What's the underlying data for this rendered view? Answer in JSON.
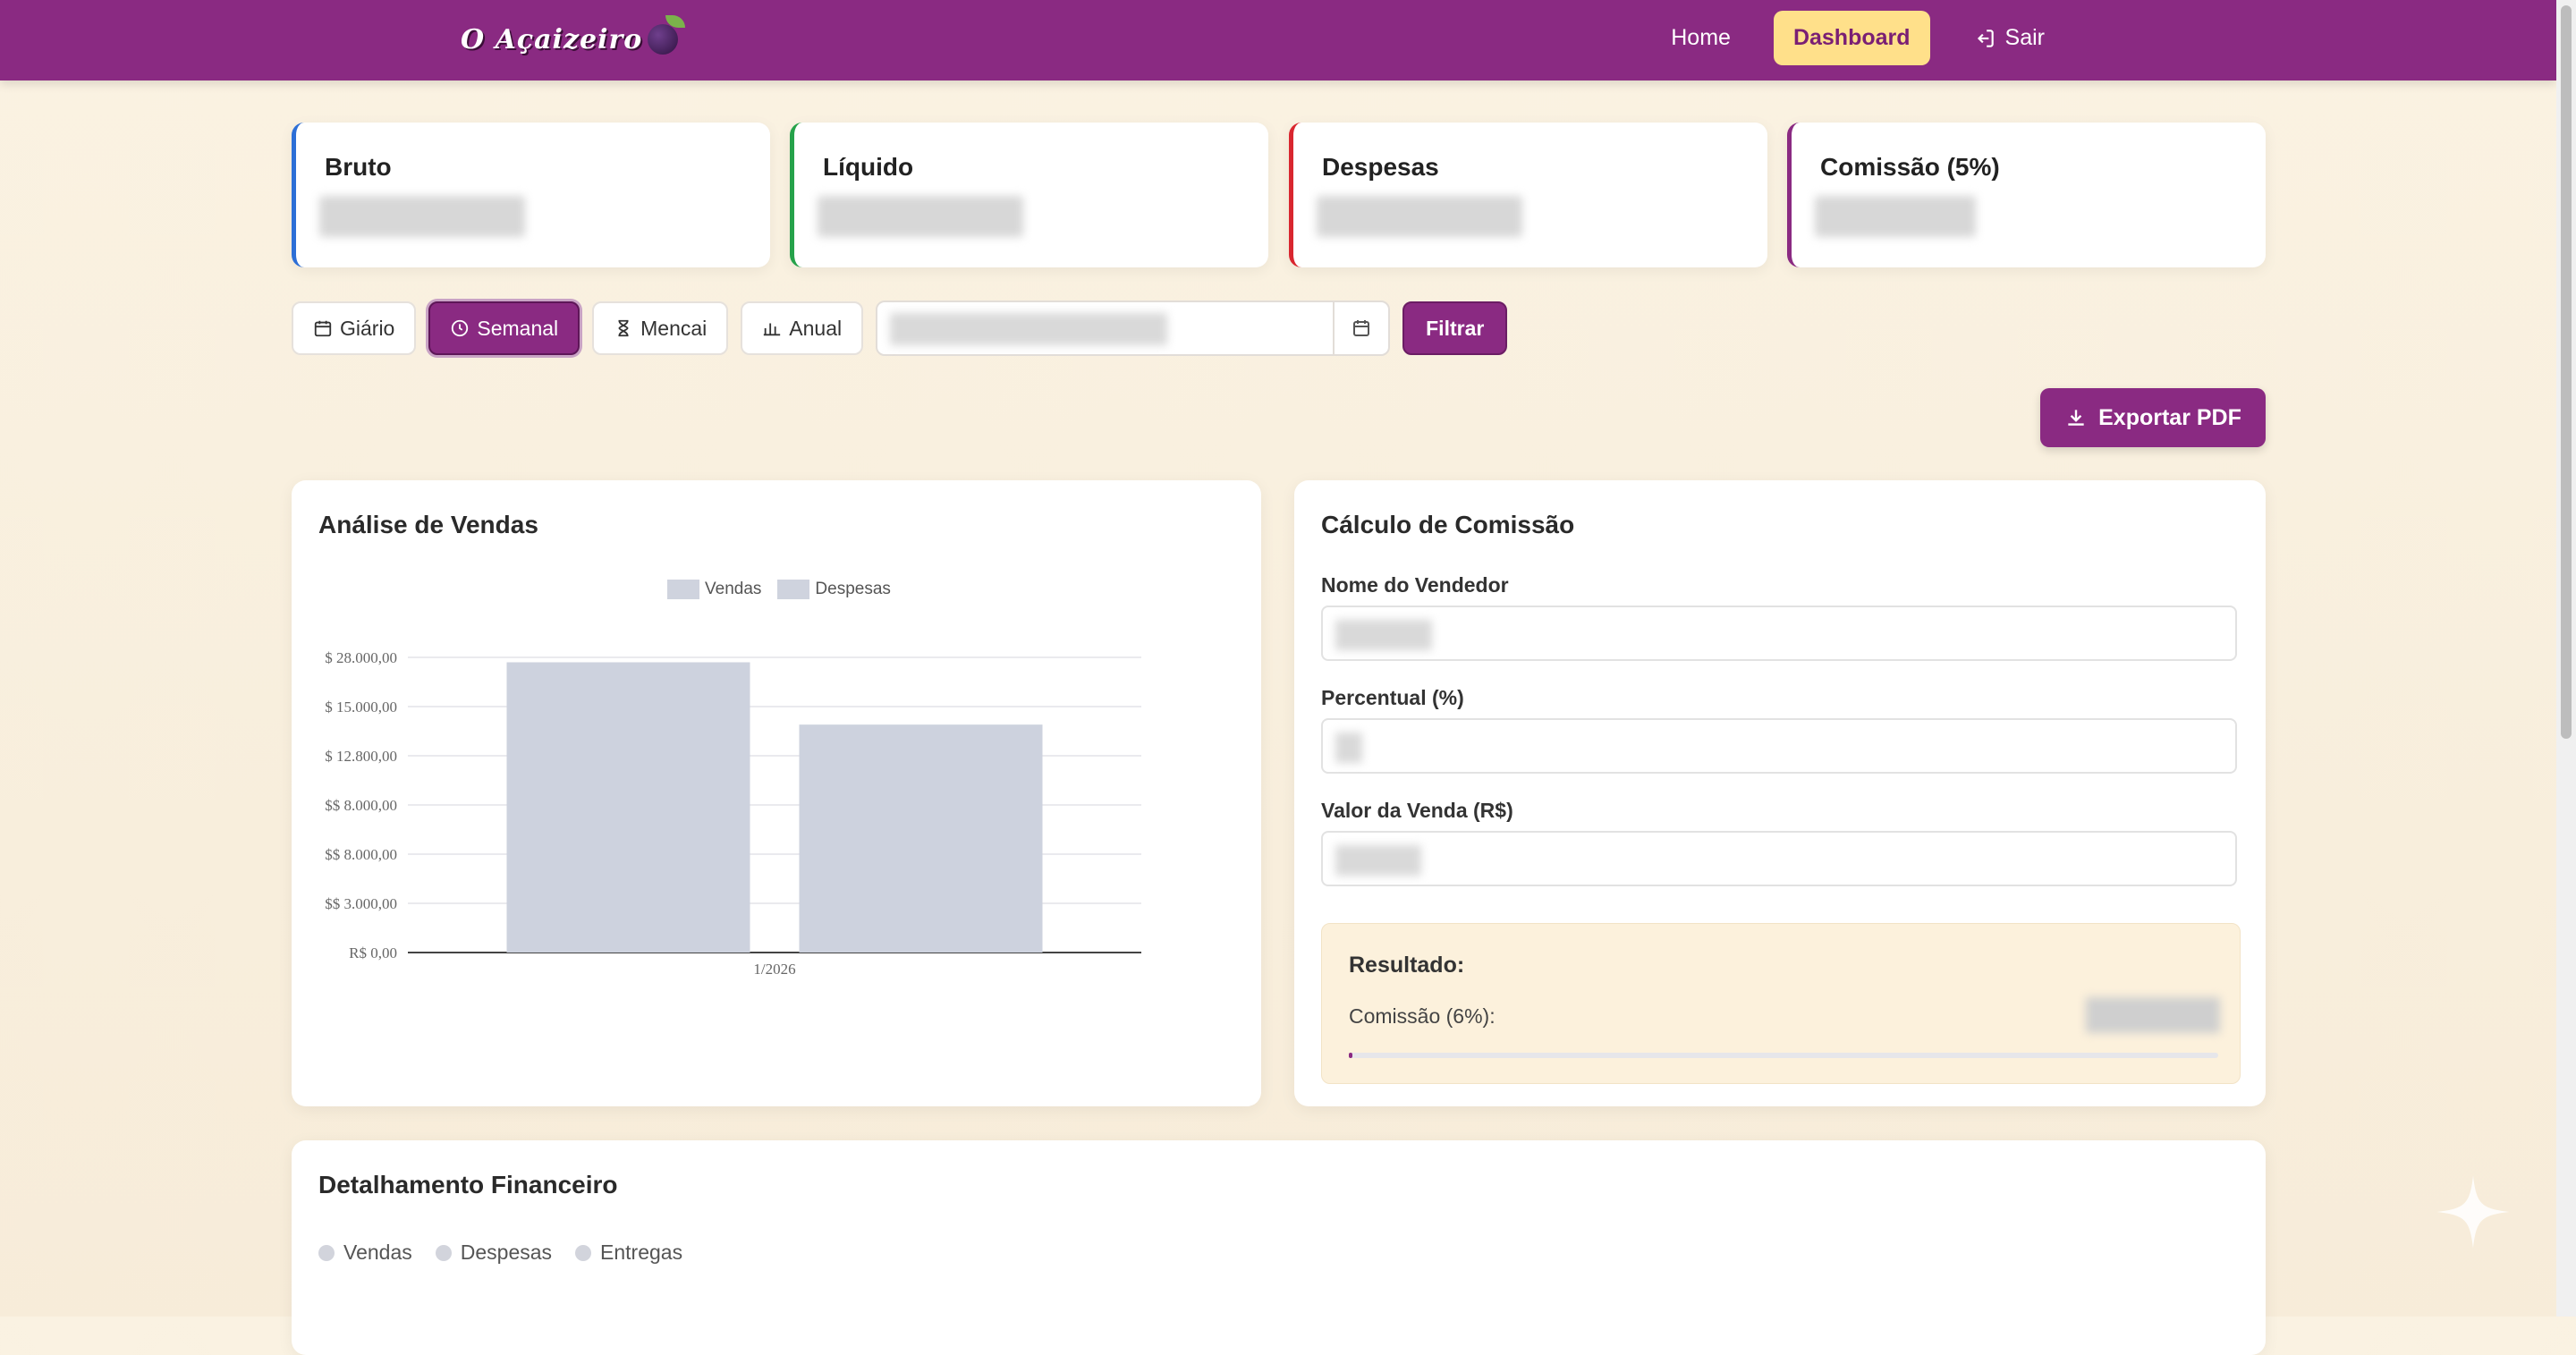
{
  "brand": {
    "logo_text": "O Açaizeiro"
  },
  "nav": {
    "home": "Home",
    "dashboard": "Dashboard",
    "logout": "Sair"
  },
  "summary_cards": [
    {
      "title": "Bruto",
      "color": "#2d6fd6"
    },
    {
      "title": "Líquido",
      "color": "#26a24a"
    },
    {
      "title": "Despesas",
      "color": "#d9262f"
    },
    {
      "title": "Comissão (5%)",
      "color": "#8a2a82"
    }
  ],
  "period_filters": {
    "daily": "Giário",
    "weekly": "Semanal",
    "monthly": "Mencai",
    "yearly": "Anual",
    "filter": "Filtrar"
  },
  "export": {
    "label": "Exportar PDF"
  },
  "sales_panel": {
    "title": "Análise de Vendas"
  },
  "chart_data": {
    "type": "bar",
    "categories": [
      "1/2026"
    ],
    "series": [
      {
        "name": "Vendas",
        "values": [
          17700
        ]
      },
      {
        "name": "Despesas",
        "values": [
          13900
        ]
      }
    ],
    "yticks": [
      "R$ 0,00",
      "$$ 3.000,00",
      "$$ 8.000,00",
      "$$ 8.000,00",
      "$ 12.800,00",
      "$ 15.000,00",
      "$ 28.000,00"
    ],
    "ytick_values": [
      0,
      3000,
      6000,
      9000,
      12000,
      15000,
      18000
    ],
    "ylim": [
      0,
      18000
    ],
    "legend": "top-center",
    "grid": true
  },
  "commission_panel": {
    "title": "Cálculo de Comissão",
    "seller_label": "Nome do Vendedor",
    "percent_label": "Percentual (%)",
    "sale_value_label": "Valor da Venda (R$)",
    "result_title": "Resultado:",
    "commission_label": "Comissão (6%):",
    "progress": 0.004
  },
  "financial_panel": {
    "title": "Detalhamento Financeiro",
    "legend": [
      "Vendas",
      "Despesas",
      "Entregas"
    ]
  }
}
